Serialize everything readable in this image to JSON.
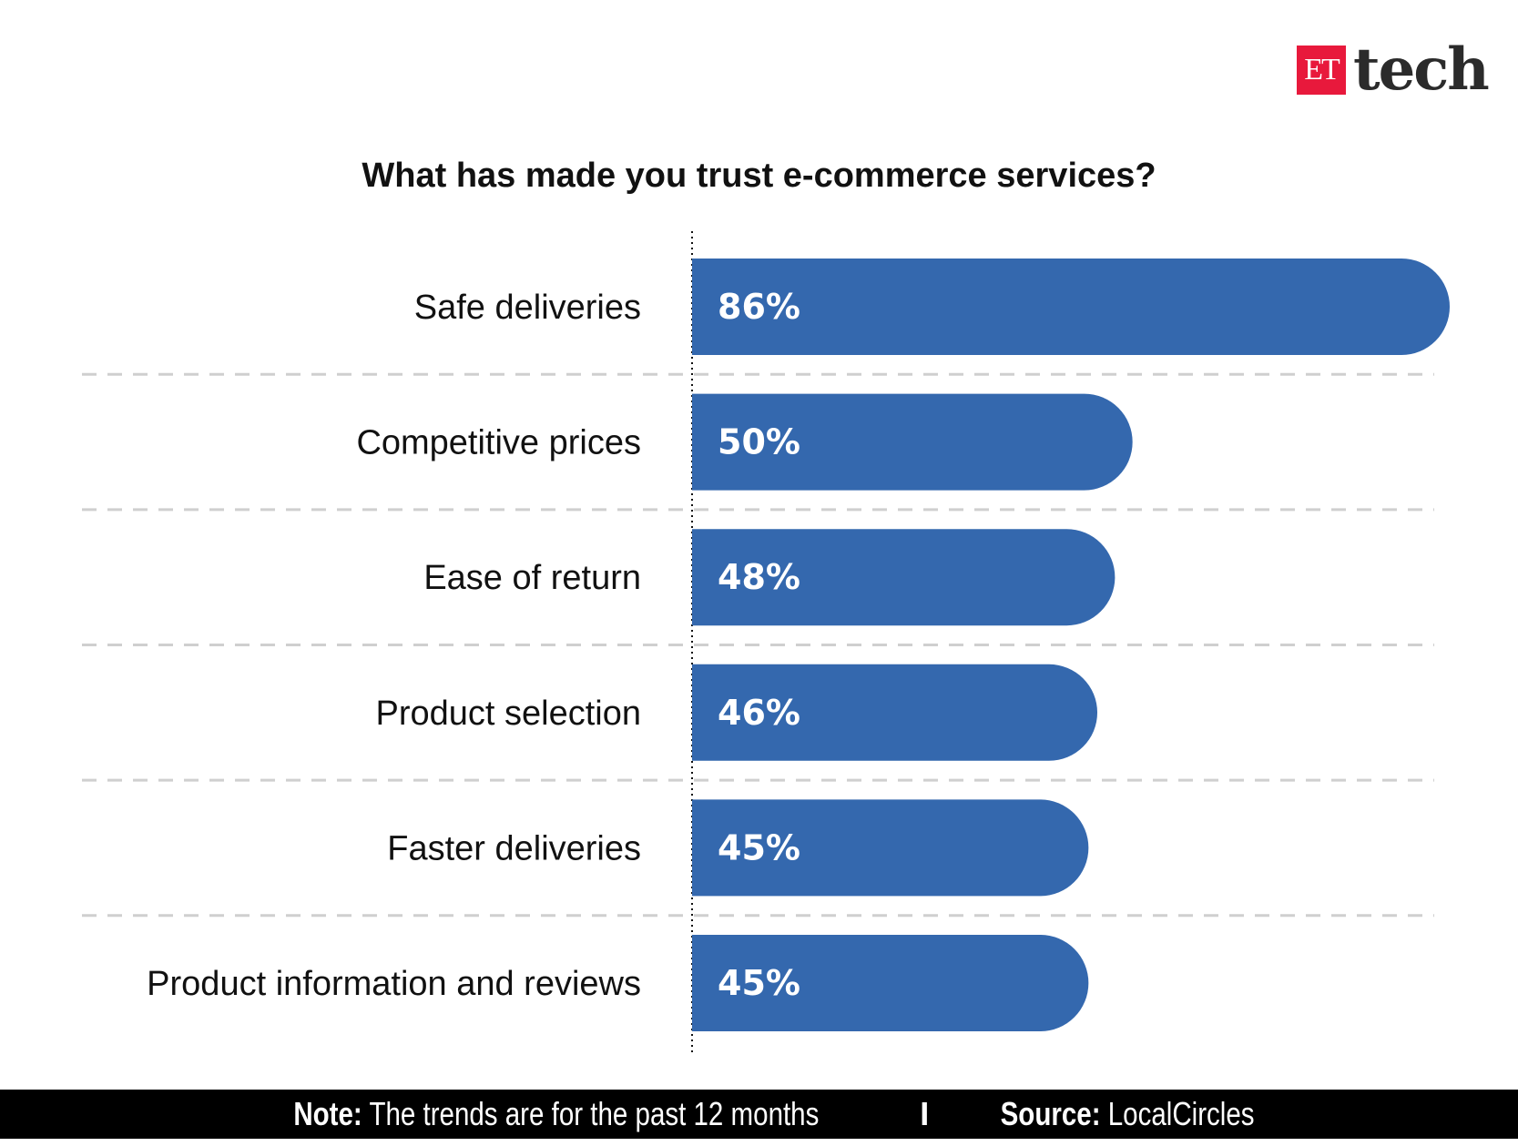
{
  "brand": {
    "et": "ET",
    "tech": "tech",
    "et_color": "#e8193c"
  },
  "chart_data": {
    "type": "bar",
    "orientation": "horizontal",
    "title": "What has made you trust e-commerce services?",
    "categories": [
      "Safe deliveries",
      "Competitive prices",
      "Ease of return",
      "Product selection",
      "Faster deliveries",
      "Product information and reviews"
    ],
    "values": [
      86,
      50,
      48,
      46,
      45,
      45
    ],
    "data_labels": [
      "86%",
      "50%",
      "48%",
      "46%",
      "45%",
      "45%"
    ],
    "unit": "%",
    "xlim": [
      0,
      86
    ],
    "bar_color": "#3468ae",
    "grid": "dashed separators between rows",
    "xlabel": "",
    "ylabel": ""
  },
  "footer": {
    "note_label": "Note:",
    "note_text": "The trends are for the past 12 months",
    "separator": "I",
    "source_label": "Source:",
    "source_text": "LocalCircles"
  }
}
